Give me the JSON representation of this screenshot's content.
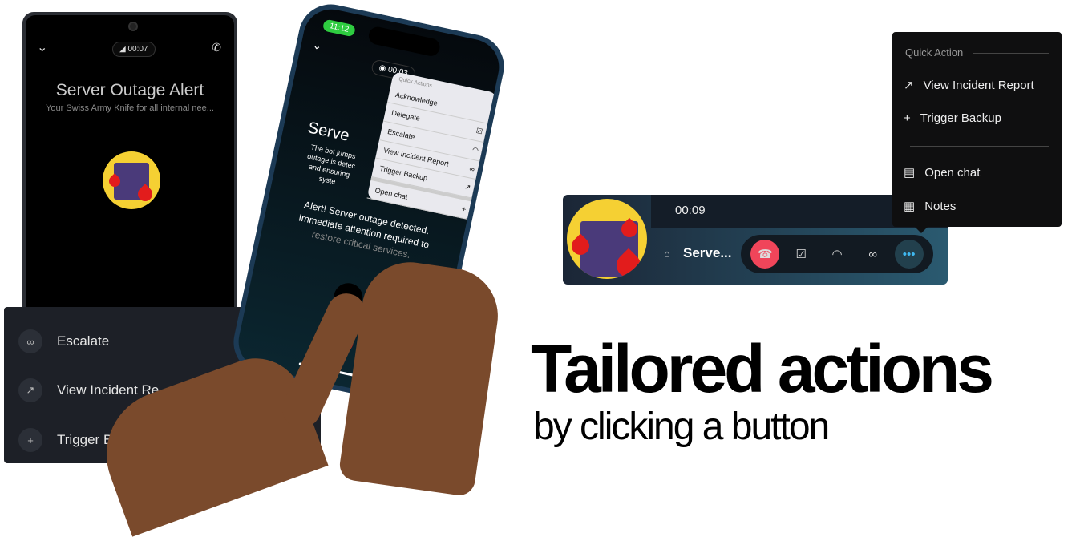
{
  "android": {
    "timer": "00:07",
    "title": "Server Outage Alert",
    "subtitle": "Your Swiss Army Knife for all internal nee..."
  },
  "panel": {
    "items": [
      {
        "label": "Escalate",
        "icon": "link-icon"
      },
      {
        "label": "View Incident Re",
        "icon": "external-link-icon"
      },
      {
        "label": "Trigger Back",
        "icon": "plus-icon"
      }
    ]
  },
  "iphone": {
    "status_time": "11:12",
    "timer": "00:03",
    "title_partial": "Serve",
    "desc_partial": [
      "The bot jumps",
      "outage is detec",
      "and ensuring",
      "syste"
    ],
    "menu_header": "Quick Actions",
    "menu": [
      {
        "label": "Acknowledge"
      },
      {
        "label": "Delegate",
        "icon": "checkbox-icon"
      },
      {
        "label": "Escalate",
        "icon": "headset-icon"
      },
      {
        "label": "View Incident Report",
        "icon": "link-icon"
      },
      {
        "label": "Trigger Backup",
        "icon": "external-link-icon"
      },
      {
        "label": "Open chat",
        "icon": "plus-icon"
      }
    ],
    "alert_line1": "Alert! Server outage detected.",
    "alert_line2": "Immediate attention required to",
    "alert_line3": "restore critical services."
  },
  "widget": {
    "timer": "00:09",
    "name": "Serve...",
    "colors": {
      "hangup": "#f0455a",
      "more": "#3fb8f0"
    }
  },
  "quick_action": {
    "header": "Quick Action",
    "items": [
      {
        "label": "View Incident Report",
        "icon": "external-link-icon"
      },
      {
        "label": "Trigger Backup",
        "icon": "plus-icon"
      },
      {
        "label": "Open chat",
        "icon": "chat-icon"
      },
      {
        "label": "Notes",
        "icon": "notes-icon"
      }
    ]
  },
  "headline": {
    "title": "Tailored actions",
    "subtitle": "by clicking a button"
  }
}
